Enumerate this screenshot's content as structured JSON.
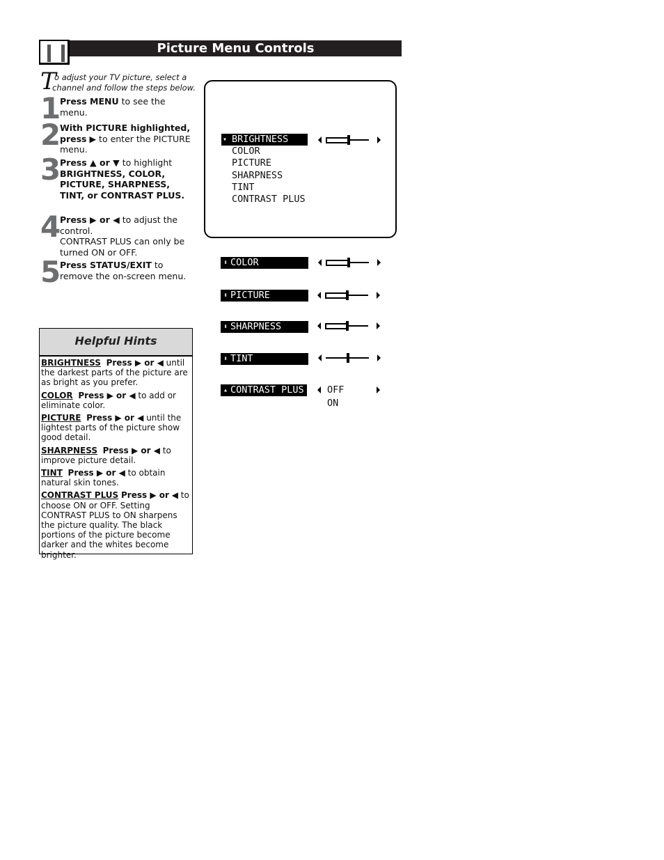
{
  "header": {
    "page_number": "11",
    "title": "Picture Menu Controls",
    "accent_color": "#231f20"
  },
  "intro": {
    "dropcap": "T",
    "line1": "o adjust your TV picture, select a",
    "line2": "channel and follow the steps below."
  },
  "steps": [
    {
      "number": "1",
      "bold": "Press MENU",
      "text": " to see the menu."
    },
    {
      "number": "2",
      "bold": "With PICTURE highlighted, press",
      "text": " ▶ to enter the PICTURE menu."
    },
    {
      "number": "3",
      "bold_a": "Press ▲ or ▼",
      "text": " to highlight ",
      "bold_b": "BRIGHTNESS, COLOR, PICTURE, SHARPNESS, TINT, or CONTRAST PLUS."
    },
    {
      "number": "4",
      "bold": "Press ▶ or ◀",
      "text": " to adjust the control.",
      "note": "CONTRAST PLUS can only be turned ON or OFF."
    },
    {
      "number": "5",
      "bold": "Press STATUS/EXIT",
      "text": " to remove the on-screen menu."
    }
  ],
  "hints": {
    "title": "Helpful Hints",
    "items": [
      {
        "key": "BRIGHTNESS",
        "action": "Press ▶ or ◀",
        "text": " until the darkest parts of the picture are as bright as you prefer."
      },
      {
        "key": "COLOR",
        "action": "Press ▶ or ◀",
        "text": " to add or eliminate color."
      },
      {
        "key": "PICTURE",
        "action": "Press ▶ or ◀",
        "text": " until the lightest parts of the picture show good detail."
      },
      {
        "key": "SHARPNESS",
        "action": "Press ▶ or ◀",
        "text": " to improve picture detail."
      },
      {
        "key": "TINT",
        "action": "Press ▶ or ◀",
        "text": " to obtain natural skin tones."
      },
      {
        "key": "CONTRAST PLUS",
        "action": "Press ▶ or",
        "text": " ◀ to choose ON or OFF. Setting CONTRAST PLUS to ON sharpens the picture quality. The black portions of the picture become darker and the whites become brighter."
      }
    ]
  },
  "tv_menu": {
    "selected_arrow": "▾",
    "items": [
      "BRIGHTNESS",
      "COLOR",
      "PICTURE",
      "SHARPNESS",
      "TINT",
      "CONTRAST PLUS"
    ],
    "selected_index": 0,
    "brightness_level": 0.53
  },
  "osd_rows": [
    {
      "label": "COLOR",
      "icon": "⬍",
      "type": "slider",
      "level": 0.53,
      "filled": true
    },
    {
      "label": "PICTURE",
      "icon": "⬍",
      "type": "slider",
      "level": 0.52,
      "filled": true
    },
    {
      "label": "SHARPNESS",
      "icon": "⬍",
      "type": "slider",
      "level": 0.52,
      "filled": true
    },
    {
      "label": "TINT",
      "icon": "⬍",
      "type": "slider",
      "level": 0.52,
      "filled": false
    },
    {
      "label": "CONTRAST PLUS",
      "icon": "▴",
      "type": "toggle",
      "values": [
        "OFF",
        "ON"
      ]
    }
  ]
}
